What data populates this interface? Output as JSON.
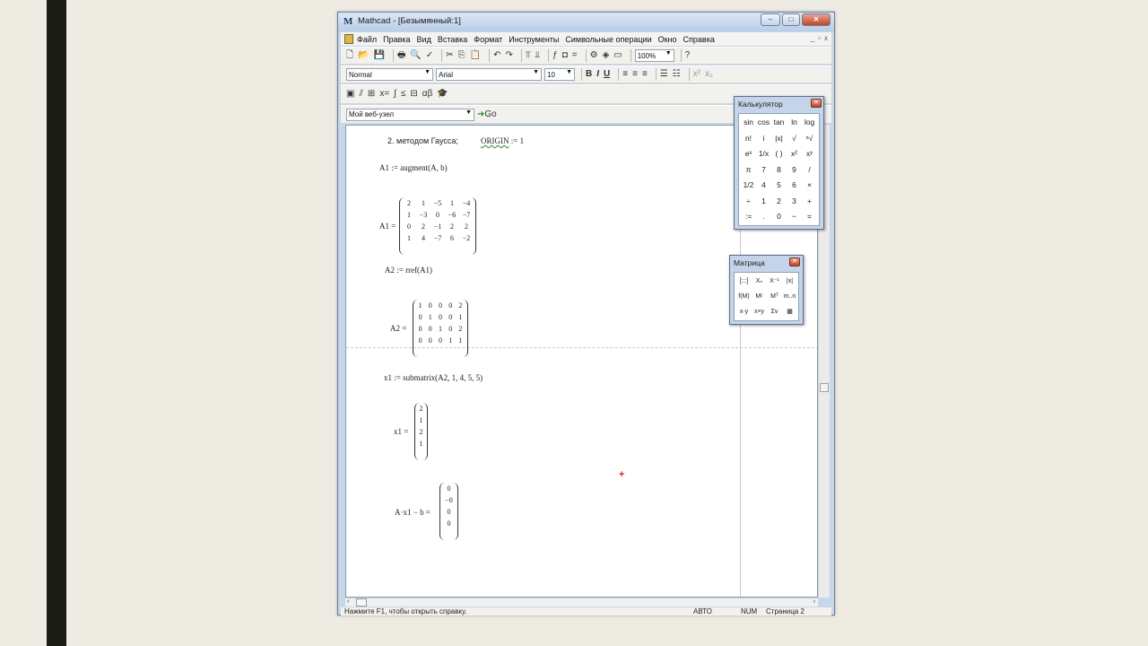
{
  "window": {
    "title": "Mathcad - [Безымянный:1]",
    "icon": "mathcad-logo-icon",
    "minimize": "‒",
    "maximize": "□",
    "close": "✕"
  },
  "menu": [
    "Файл",
    "Правка",
    "Вид",
    "Вставка",
    "Формат",
    "Инструменты",
    "Символьные операции",
    "Окно",
    "Справка"
  ],
  "toolbar": {
    "zoom": "100%",
    "style": "Normal",
    "font": "Arial",
    "size": "10",
    "bold": "B",
    "italic": "I",
    "underline": "U"
  },
  "webbar": {
    "url": "Мой веб-узел",
    "go": "Go"
  },
  "worksheet": {
    "heading": "2. методом Гаусса;",
    "origin_word": "ORIGIN",
    "origin_value": ":= 1",
    "a1_def": "A1 := augment(A, b)",
    "a1_lbl": "A1 =",
    "a1": [
      [
        "2",
        "1",
        "−5",
        "1",
        "−4"
      ],
      [
        "1",
        "−3",
        "0",
        "−6",
        "−7"
      ],
      [
        "0",
        "2",
        "−1",
        "2",
        "2"
      ],
      [
        "1",
        "4",
        "−7",
        "6",
        "−2"
      ]
    ],
    "a2_def": "A2 := rref(A1)",
    "a2_lbl": "A2 =",
    "a2": [
      [
        "1",
        "0",
        "0",
        "0",
        "2"
      ],
      [
        "0",
        "1",
        "0",
        "0",
        "1"
      ],
      [
        "0",
        "0",
        "1",
        "0",
        "2"
      ],
      [
        "0",
        "0",
        "0",
        "1",
        "1"
      ]
    ],
    "x1_def": "x1 := submatrix(A2, 1, 4, 5, 5)",
    "x1_lbl": "x1 =",
    "x1": [
      "2",
      "1",
      "2",
      "1"
    ],
    "check_lbl": "A·x1 − b =",
    "check": [
      "0",
      "−0",
      "0",
      "0"
    ]
  },
  "calculator": {
    "title": "Калькулятор",
    "keys": [
      "sin",
      "cos",
      "tan",
      "ln",
      "log",
      "n!",
      "i",
      "|x|",
      "√",
      "ⁿ√",
      "eˣ",
      "1/x",
      "( )",
      "x²",
      "xʸ",
      "π",
      "7",
      "8",
      "9",
      "/",
      "1/2",
      "4",
      "5",
      "6",
      "×",
      "÷",
      "1",
      "2",
      "3",
      "+",
      ":=",
      ".",
      "0",
      "−",
      "="
    ]
  },
  "matrix_palette": {
    "title": "Матрица",
    "keys": [
      "[:::]",
      "Xₙ",
      "X⁻¹",
      "|x|",
      "f(M)",
      "Mᶜ",
      "Mᵀ",
      "m..n",
      "x·y",
      "x×y",
      "Σv",
      "▦"
    ]
  },
  "status": {
    "help": "Нажмите F1, чтобы открыть справку.",
    "mode": "АВТО",
    "num": "NUM",
    "page": "Страница 2"
  }
}
